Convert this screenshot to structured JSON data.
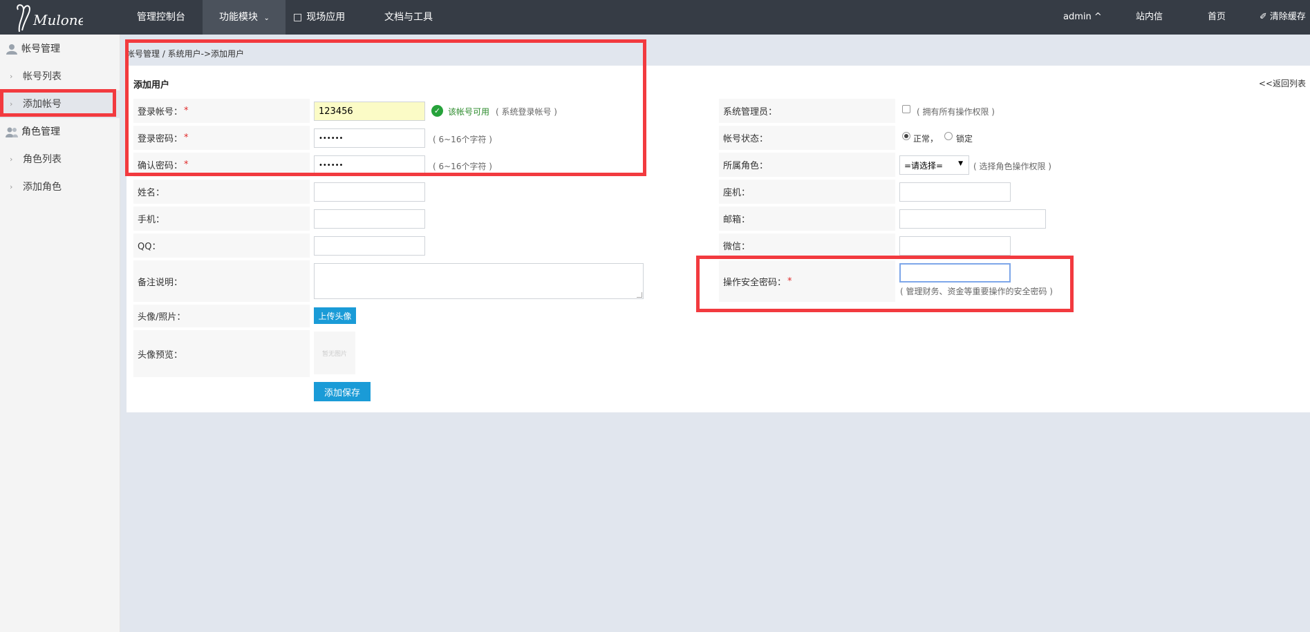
{
  "topbar": {
    "logo_text": "Mulone",
    "nav": [
      "管理控制台",
      "功能模块",
      "现场应用",
      "文档与工具"
    ],
    "user": "admin ^",
    "messages": "站内信",
    "home": "首页",
    "clear_cache": "清除缓存"
  },
  "sidebar": {
    "group1": "帐号管理",
    "item_account_list": "帐号列表",
    "item_add_account": "添加帐号",
    "group2": "角色管理",
    "item_role_list": "角色列表",
    "item_add_role": "添加角色"
  },
  "breadcrumb": "帐号管理 / 系统用户->添加用户",
  "panel": {
    "title": "添加用户",
    "back": "<<返回列表"
  },
  "form_left": {
    "login_label": "登录帐号：",
    "login_value": "123456",
    "login_ok": "该帐号可用",
    "login_hint": "( 系统登录帐号 )",
    "password_label": "登录密码：",
    "password_value": "••••••",
    "password_hint": "( 6~16个字符 )",
    "confirm_label": "确认密码：",
    "confirm_value": "••••••",
    "confirm_hint": "( 6~16个字符 )",
    "name_label": "姓名：",
    "mobile_label": "手机：",
    "qq_label": "QQ：",
    "remark_label": "备注说明：",
    "photo_label": "头像/照片：",
    "upload_button": "上传头像",
    "preview_label": "头像预览：",
    "preview_placeholder": "暂无图片",
    "save_button": "添加保存"
  },
  "form_right": {
    "admin_label": "系统管理员：",
    "admin_hint": "( 拥有所有操作权限 )",
    "status_label": "帐号状态：",
    "status_normal": "正常，",
    "status_locked": "锁定",
    "role_label": "所属角色：",
    "role_select": "=请选择=",
    "role_hint": "( 选择角色操作权限 )",
    "phone_label": "座机：",
    "email_label": "邮箱：",
    "wechat_label": "微信：",
    "security_label": "操作安全密码：",
    "security_hint": "( 管理财务、资金等重要操作的安全密码 )"
  },
  "required_mark": "*"
}
